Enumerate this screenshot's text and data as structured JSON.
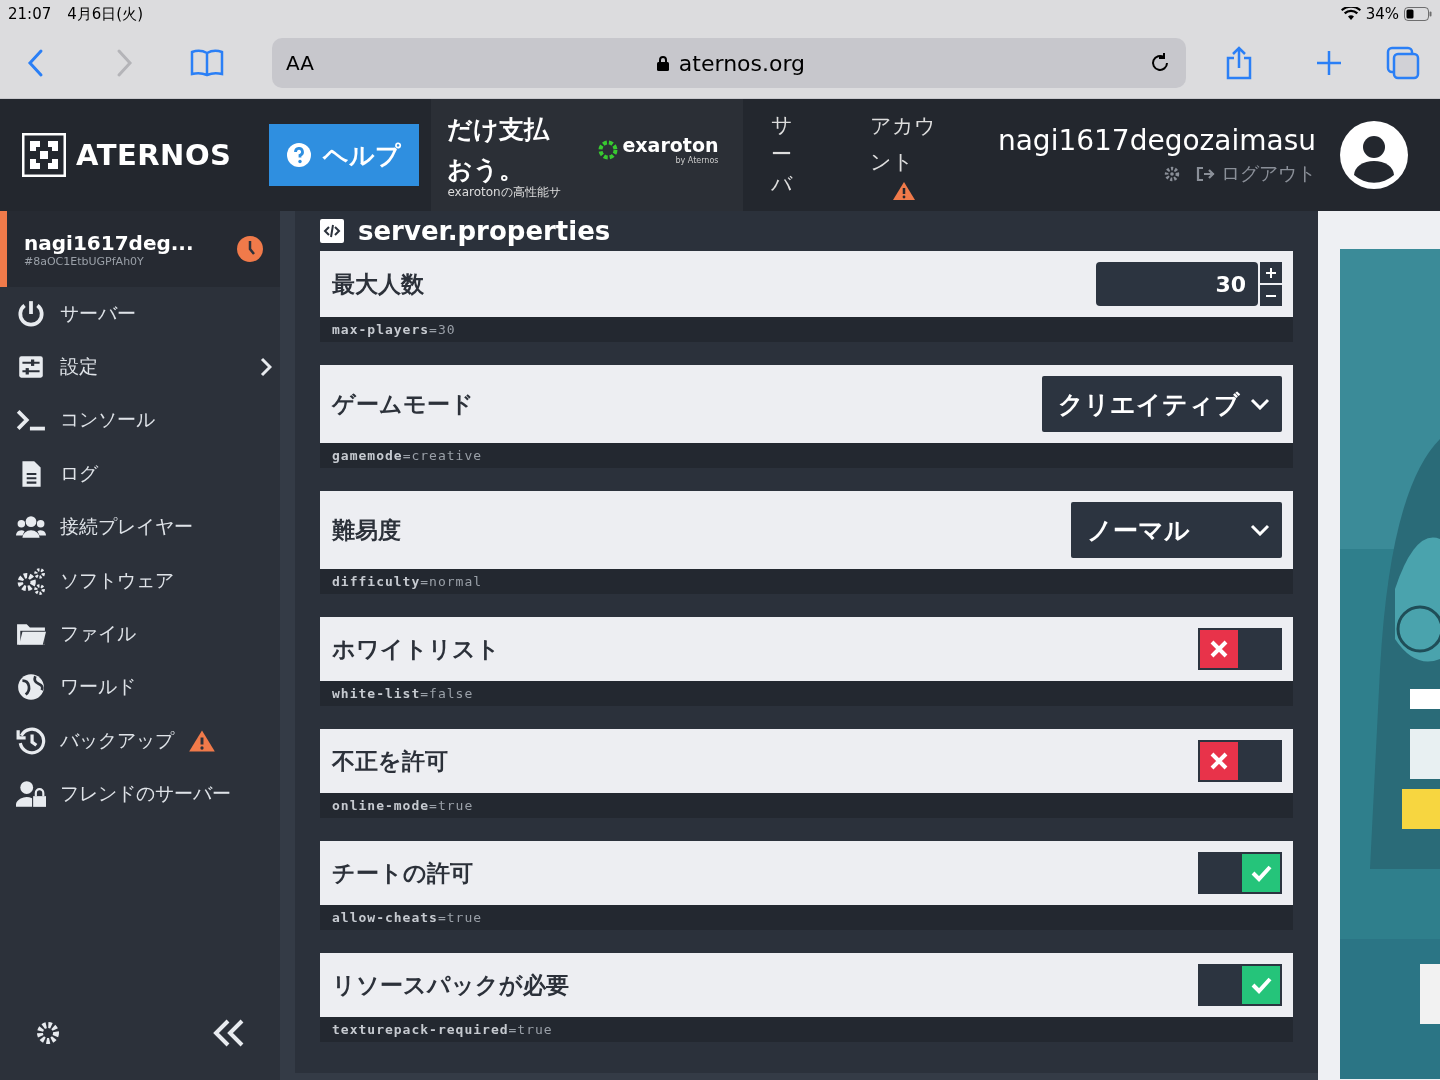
{
  "status_bar": {
    "time": "21:07",
    "date": "4月6日(火)",
    "battery": "34%"
  },
  "browser": {
    "text_size": "AA",
    "url": "aternos.org"
  },
  "header": {
    "logo": "ATERNOS",
    "help": "ヘルプ",
    "ad": {
      "headline": "だけ支払おう。",
      "brand": "exaroton",
      "brand_sub": "by Aternos",
      "caption": "exarotonの高性能サ"
    },
    "nav": [
      {
        "label": "サーバ",
        "warning": false
      },
      {
        "label": "アカウント",
        "warning": true
      }
    ],
    "user": {
      "name": "nagi1617degozaimasu",
      "logout": "ログアウト"
    }
  },
  "server": {
    "name": "nagi1617deg...",
    "id": "#8aOC1EtbUGPfAh0Y"
  },
  "sidebar": {
    "items": [
      {
        "label": "サーバー",
        "warning": false,
        "expandable": false
      },
      {
        "label": "設定",
        "warning": false,
        "expandable": true
      },
      {
        "label": "コンソール",
        "warning": false,
        "expandable": false
      },
      {
        "label": "ログ",
        "warning": false,
        "expandable": false
      },
      {
        "label": "接続プレイヤー",
        "warning": false,
        "expandable": false
      },
      {
        "label": "ソフトウェア",
        "warning": false,
        "expandable": false
      },
      {
        "label": "ファイル",
        "warning": false,
        "expandable": false
      },
      {
        "label": "ワールド",
        "warning": false,
        "expandable": false
      },
      {
        "label": "バックアップ",
        "warning": true,
        "expandable": false
      },
      {
        "label": "フレンドのサーバー",
        "warning": false,
        "expandable": false
      }
    ]
  },
  "section_title": "server.properties",
  "properties": [
    {
      "kind": "number",
      "label": "最大人数",
      "value": "30",
      "setting": "**max-players**=30"
    },
    {
      "kind": "select",
      "label": "ゲームモード",
      "value": "クリエイティブ",
      "setting": "**gamemode**=creative"
    },
    {
      "kind": "select",
      "label": "難易度",
      "value": "ノーマル",
      "setting": "**difficulty**=normal"
    },
    {
      "kind": "toggle",
      "label": "ホワイトリスト",
      "checked": false,
      "setting": "**white-list**=false"
    },
    {
      "kind": "toggle",
      "label": "不正を許可",
      "checked": false,
      "setting": "**online-mode**=true"
    },
    {
      "kind": "toggle",
      "label": "チートの許可",
      "checked": true,
      "setting": "**allow-cheats**=true"
    },
    {
      "kind": "toggle",
      "label": "リソースパックが必要",
      "checked": true,
      "setting": "**texturepack-required**=true"
    }
  ]
}
